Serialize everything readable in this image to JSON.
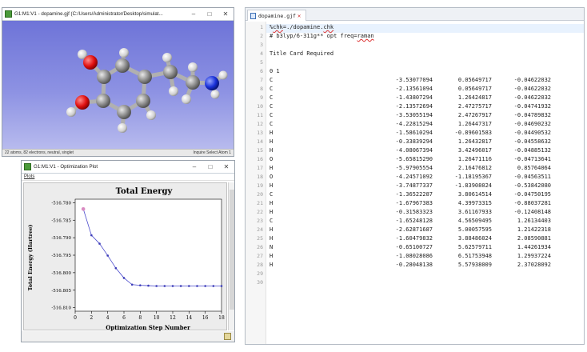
{
  "molecule_window": {
    "title": "G1:M1:V1 - dopamine.gjf (C:/Users/Administrator/Desktop/simulat...",
    "minimize": "–",
    "maximize": "□",
    "close": "✕",
    "status_left": "22 atoms, 82 electrons, neutral, singlet",
    "status_right": "Inquire Select Atom 1"
  },
  "plot_window": {
    "title": "G1:M1:V1 - Optimization Plot",
    "minimize": "–",
    "maximize": "□",
    "close": "✕",
    "menu": "Plots"
  },
  "chart_data": {
    "type": "line",
    "title": "Total Energy",
    "xlabel": "Optimization Step Number",
    "ylabel": "Total Energy (Hartree)",
    "xlim": [
      0,
      18
    ],
    "ylim": [
      -516.811,
      -516.779
    ],
    "xticks": [
      "0",
      "2",
      "4",
      "6",
      "8",
      "10",
      "12",
      "14",
      "16",
      "18"
    ],
    "yticks": [
      "-516.780",
      "-516.785",
      "-516.790",
      "-516.795",
      "-516.800",
      "-516.805",
      "-516.810"
    ],
    "series": [
      {
        "x": [
          1,
          2,
          3,
          4,
          5,
          6,
          7,
          8,
          9,
          10,
          11,
          12,
          13,
          14,
          15,
          16,
          17,
          18
        ],
        "y": [
          -516.7818,
          -516.7893,
          -516.7917,
          -516.7951,
          -516.7987,
          -516.8015,
          -516.8034,
          -516.8036,
          -516.8037,
          -516.8038,
          -516.8038,
          -516.8038,
          -516.8038,
          -516.8038,
          -516.8038,
          -516.8038,
          -516.8038,
          -516.8038
        ]
      }
    ],
    "colors": {
      "line": "#4a4acc",
      "point": "#3c3cb8",
      "first_point": "#d98bc2"
    },
    "grid": false
  },
  "editor": {
    "tab_label": "dopamine.gjf",
    "header_lines": [
      {
        "n": "1",
        "text_pre": "%",
        "text_link": "chk",
        "text_post": "=./dopamine.",
        "text_link2": "chk"
      },
      {
        "n": "2",
        "text": "# b3lyp/6-311g** opt freq=",
        "text_link": "raman"
      },
      {
        "n": "3",
        "text": ""
      },
      {
        "n": "4",
        "text": "Title Card Required"
      },
      {
        "n": "5",
        "text": ""
      },
      {
        "n": "6",
        "text": "0 1"
      }
    ],
    "atoms": [
      {
        "n": "7",
        "el": "C",
        "x": "-3.53077094",
        "y": "0.05649717",
        "z": "-0.04622032"
      },
      {
        "n": "8",
        "el": "C",
        "x": "-2.13561094",
        "y": "0.05649717",
        "z": "-0.04622032"
      },
      {
        "n": "9",
        "el": "C",
        "x": "-1.43807294",
        "y": "1.26424817",
        "z": "-0.04622032"
      },
      {
        "n": "10",
        "el": "C",
        "x": "-2.13572694",
        "y": "2.47275717",
        "z": "-0.04741932"
      },
      {
        "n": "11",
        "el": "C",
        "x": "-3.53055194",
        "y": "2.47267917",
        "z": "-0.04789832"
      },
      {
        "n": "12",
        "el": "C",
        "x": "-4.22815294",
        "y": "1.26447317",
        "z": "-0.04690232"
      },
      {
        "n": "13",
        "el": "H",
        "x": "-1.58610294",
        "y": "-0.89601583",
        "z": "-0.04490532"
      },
      {
        "n": "14",
        "el": "H",
        "x": "-0.33839294",
        "y": "1.26432817",
        "z": "-0.04558632"
      },
      {
        "n": "15",
        "el": "H",
        "x": "-4.08067394",
        "y": "3.42496017",
        "z": "-0.04885132"
      },
      {
        "n": "16",
        "el": "O",
        "x": "-5.65815290",
        "y": "1.26471116",
        "z": "-0.04713641"
      },
      {
        "n": "17",
        "el": "H",
        "x": "-5.97905554",
        "y": "2.16476812",
        "z": "0.85764064"
      },
      {
        "n": "18",
        "el": "O",
        "x": "-4.24571092",
        "y": "-1.18195367",
        "z": "-0.04563511"
      },
      {
        "n": "19",
        "el": "H",
        "x": "-3.74877337",
        "y": "-1.83908024",
        "z": "-0.53842080"
      },
      {
        "n": "20",
        "el": "C",
        "x": "-1.36522287",
        "y": "3.80614514",
        "z": "-0.04750195"
      },
      {
        "n": "21",
        "el": "H",
        "x": "-1.67967383",
        "y": "4.39973315",
        "z": "-0.88037281"
      },
      {
        "n": "22",
        "el": "H",
        "x": "-0.31583323",
        "y": "3.61167933",
        "z": "-0.12408148"
      },
      {
        "n": "23",
        "el": "C",
        "x": "-1.65248128",
        "y": "4.56509495",
        "z": "1.26134403"
      },
      {
        "n": "24",
        "el": "H",
        "x": "-2.62871687",
        "y": "5.00057595",
        "z": "1.21422318"
      },
      {
        "n": "25",
        "el": "H",
        "x": "-1.60479832",
        "y": "3.88486024",
        "z": "2.08590881"
      },
      {
        "n": "26",
        "el": "N",
        "x": "-0.65100727",
        "y": "5.62579711",
        "z": "1.44261934"
      },
      {
        "n": "27",
        "el": "H",
        "x": "-1.08028086",
        "y": "6.51753948",
        "z": "1.29937224"
      },
      {
        "n": "28",
        "el": "H",
        "x": "-0.28048138",
        "y": "5.57938009",
        "z": "2.37028092"
      }
    ],
    "trailing_lines": [
      "29",
      "30"
    ]
  }
}
